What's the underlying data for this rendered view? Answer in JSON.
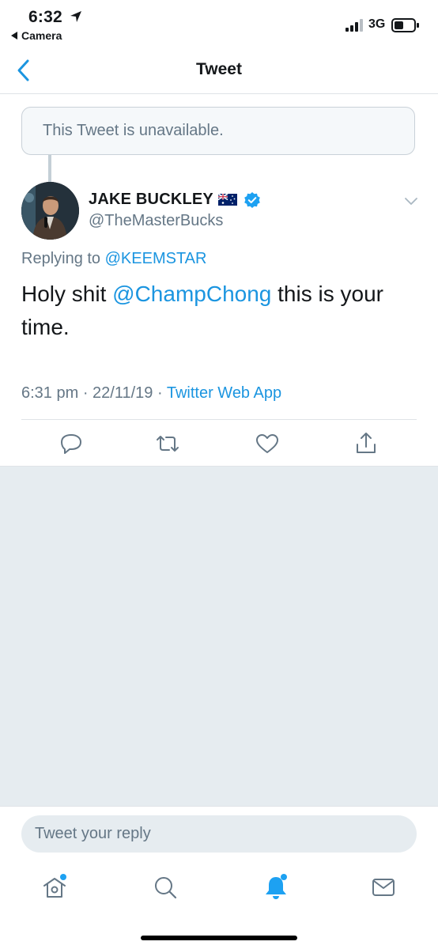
{
  "status_bar": {
    "time": "6:32",
    "back_app": "Camera",
    "network": "3G"
  },
  "nav": {
    "title": "Tweet"
  },
  "unavailable": {
    "text": "This Tweet is unavailable."
  },
  "tweet": {
    "author_name": "JAKE BUCKLEY",
    "author_handle": "@TheMasterBucks",
    "replying_prefix": "Replying to ",
    "replying_to": "@KEEMSTAR",
    "text_before": "Holy shit ",
    "mention": "@ChampChong",
    "text_after": " this is your time.",
    "time": "6:31 pm",
    "separator": " · ",
    "date": "22/11/19",
    "source": "Twitter Web App"
  },
  "compose": {
    "placeholder": "Tweet your reply"
  },
  "colors": {
    "accent": "#1b95e0",
    "muted": "#657786",
    "background_gray": "#e6ecf0"
  },
  "icons": {
    "reply": "reply-icon",
    "retweet": "retweet-icon",
    "like": "heart-icon",
    "share": "share-icon",
    "home": "home-icon",
    "search": "search-icon",
    "notifications": "bell-icon",
    "messages": "envelope-icon"
  }
}
